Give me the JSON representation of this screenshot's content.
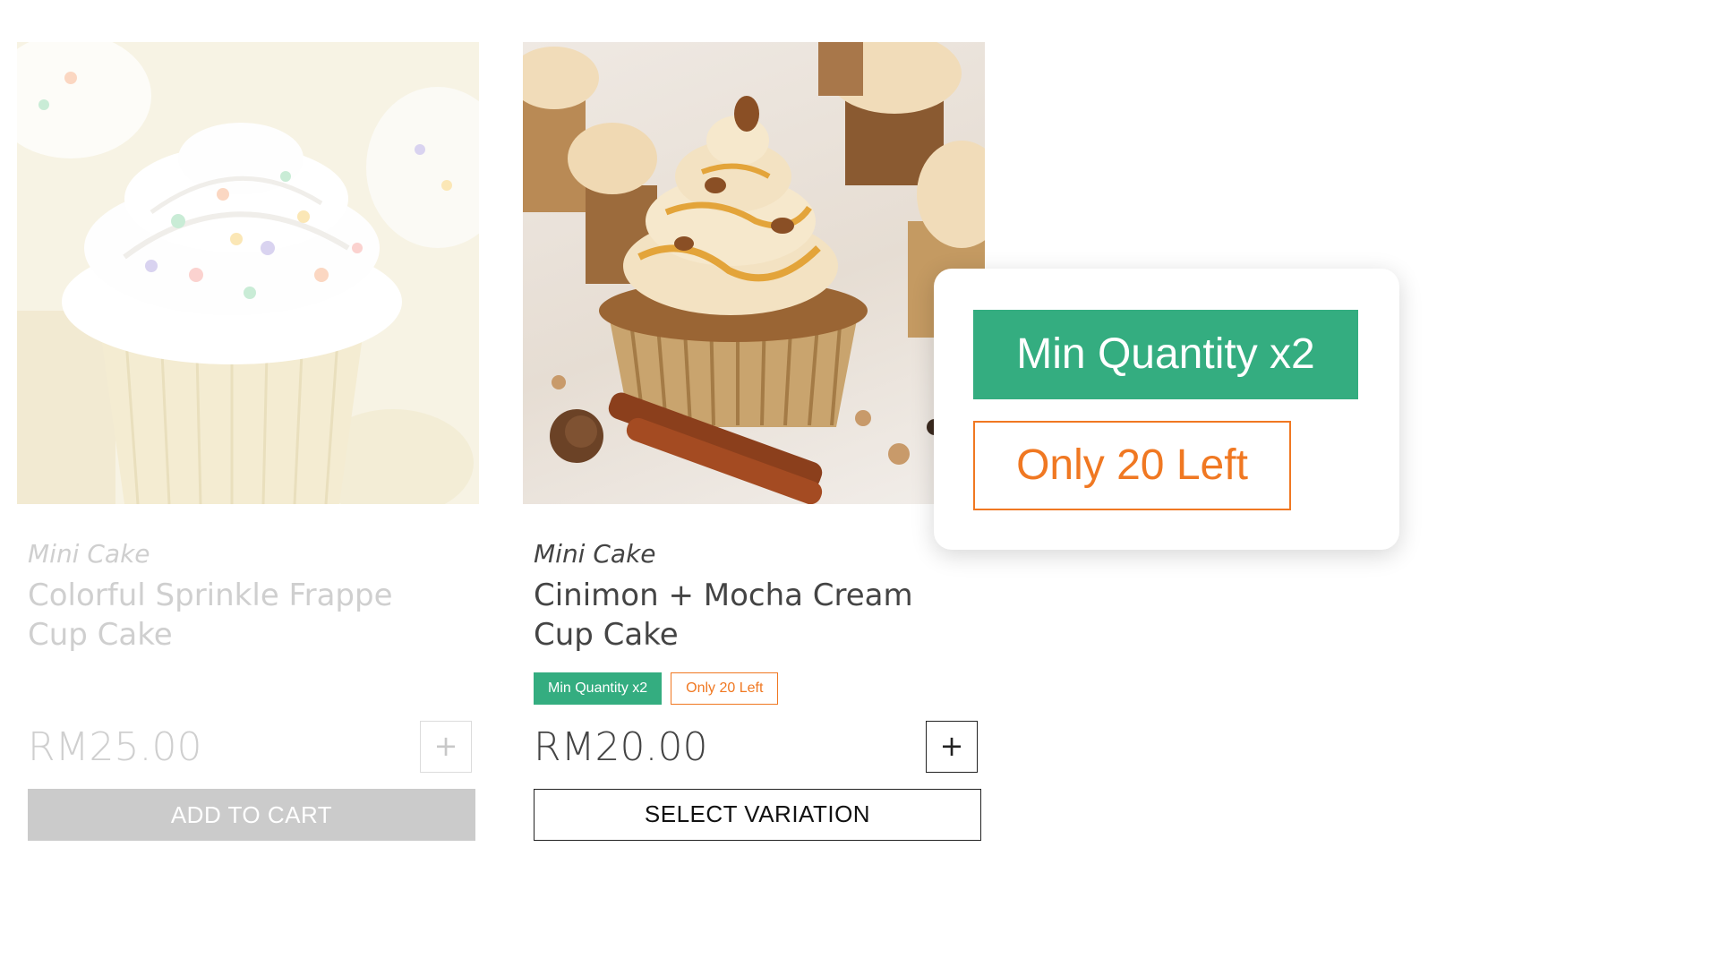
{
  "products": [
    {
      "category": "Mini Cake",
      "title_line1": "Colorful Sprinkle Frappe",
      "title_line2": "Cup Cake",
      "price": "RM25.00",
      "plus_label": "+",
      "cta_label": "ADD TO CART",
      "image_icon": "vanilla-sprinkle-cupcake-photo",
      "faded": true
    },
    {
      "category": "Mini Cake",
      "title_line1": "Cinimon + Mocha Cream",
      "title_line2": "Cup Cake",
      "badges": {
        "min_quantity": "Min Quantity x2",
        "stock": "Only 20 Left"
      },
      "price": "RM20.00",
      "plus_label": "+",
      "cta_label": "SELECT VARIATION",
      "image_icon": "cinnamon-mocha-cupcake-photo",
      "faded": false
    }
  ],
  "zoom_popup": {
    "min_quantity": "Min Quantity x2",
    "stock": "Only 20 Left"
  },
  "colors": {
    "badge_green": "#34ad80",
    "badge_orange": "#f07822",
    "text_dark": "#444444",
    "text_faded": "#cfcfcf",
    "cta_grey": "#cbcbcb"
  }
}
